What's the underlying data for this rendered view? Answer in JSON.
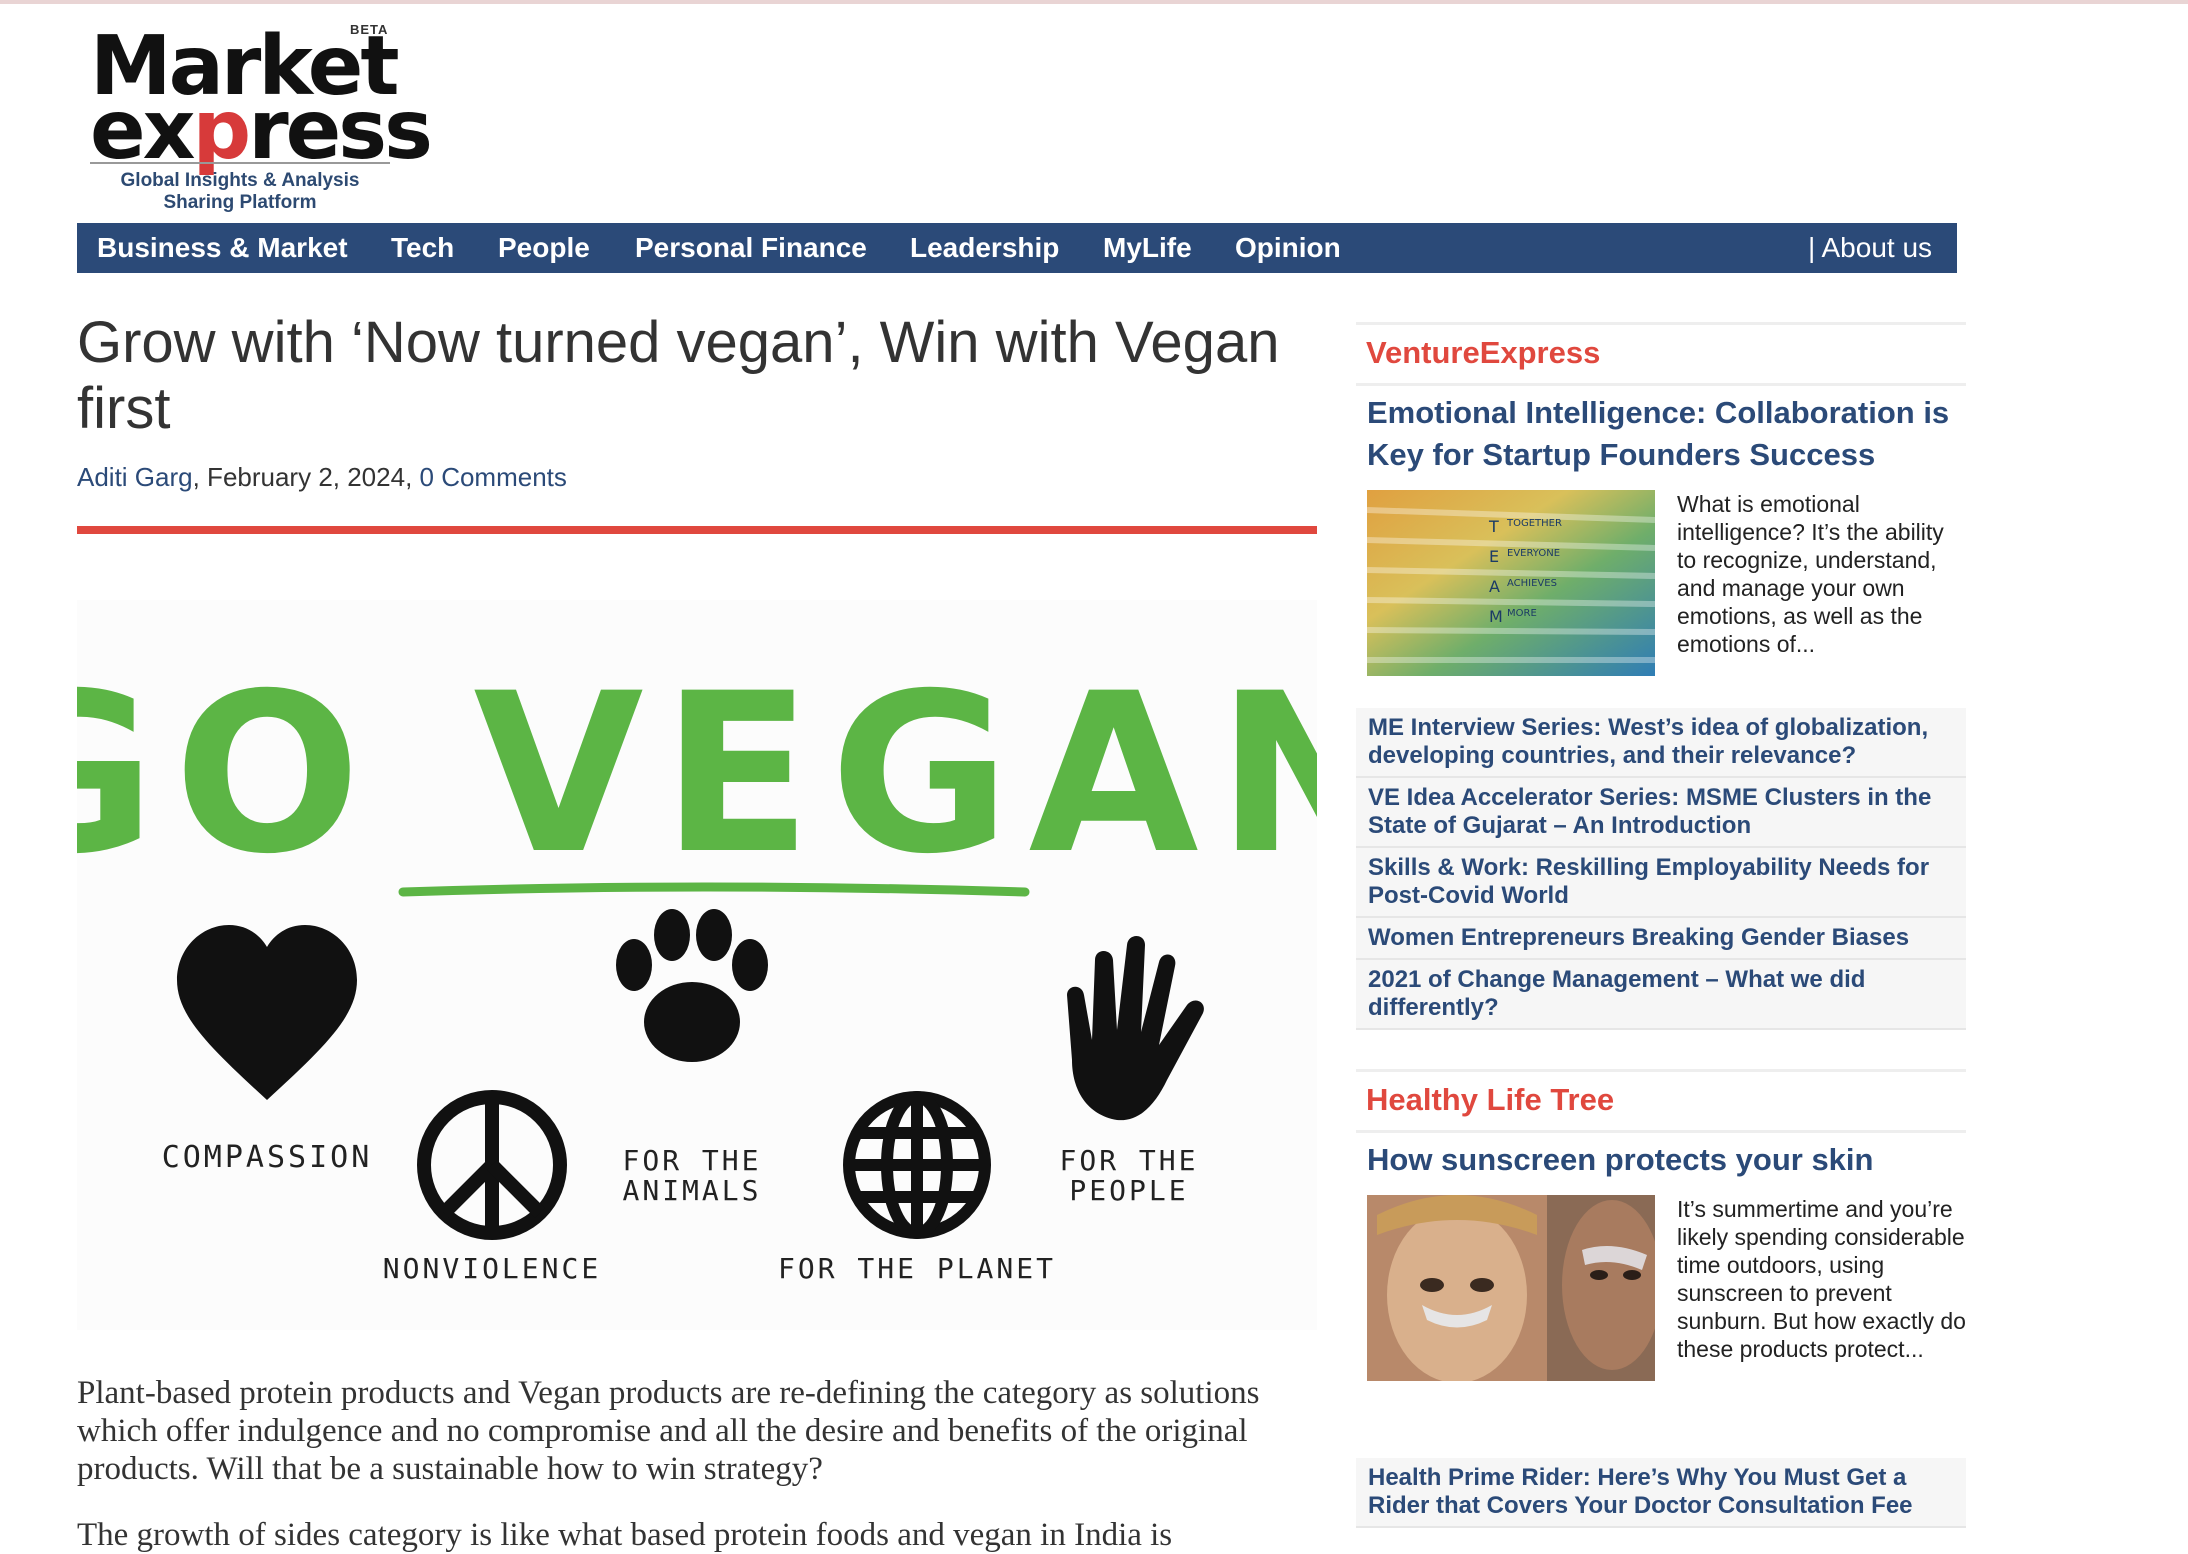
{
  "logo": {
    "beta": "BETA",
    "line1": "Market",
    "line2_a": "ex",
    "line2_p": "p",
    "line2_b": "ress",
    "tagline1": "Global Insights & Analysis",
    "tagline2": "Sharing Platform"
  },
  "nav": {
    "items": [
      "Business & Market",
      "Tech",
      "People",
      "Personal Finance",
      "Leadership",
      "MyLife",
      "Opinion"
    ],
    "about": "| About us"
  },
  "article": {
    "title": "Grow with ‘Now turned vegan’, Win with Vegan first",
    "author": "Aditi Garg",
    "date": ", February 2, 2024, ",
    "comments": "0 Comments",
    "hero": {
      "headline": "GO VEGAN",
      "labels": [
        "COMPASSION",
        "NONVIOLENCE",
        "FOR THE",
        "ANIMALS",
        "FOR THE PLANET",
        "FOR THE",
        "PEOPLE"
      ]
    },
    "paragraph1": "Plant-based protein products and Vegan products are re-defining the category as solutions which offer indulgence and no compromise and all the desire and benefits of the original products. Will that be a sustainable how to win strategy?",
    "paragraph2": "The growth of sides category is like what based protein foods and vegan in India is"
  },
  "sidebar": {
    "venture": {
      "heading": "VentureExpress",
      "feature_title": "Emotional Intelligence: Collaboration is Key for Startup Founders Success",
      "feature_text": "What is emotional intelligence? It’s the ability to recognize, understand, and manage your own emotions, as well as the emotions of...",
      "image_words": [
        "T",
        "TOGETHER",
        "E",
        "EVERYONE",
        "A",
        "ACHIEVES",
        "M",
        "MORE"
      ],
      "links": [
        "ME Interview Series: West’s idea of globalization, developing countries, and their relevance?",
        "VE Idea Accelerator Series: MSME Clusters in the State of Gujarat – An Introduction",
        "Skills & Work: Reskilling Employability Needs for Post-Covid World",
        "Women Entrepreneurs Breaking Gender Biases",
        "2021 of Change Management – What we did differently?"
      ]
    },
    "health": {
      "heading": "Healthy Life Tree",
      "feature_title": "How sunscreen protects your skin",
      "feature_text": "It’s summertime and you’re likely spending considerable time outdoors, using sunscreen to prevent sunburn. But how exactly do these products protect...",
      "links": [
        "Health Prime Rider: Here’s Why You Must Get a Rider that Covers Your Doctor Consultation Fee"
      ]
    }
  },
  "colors": {
    "nav_bg": "#2b4a78",
    "accent_red": "#e0483e",
    "link_blue": "#2b4a78",
    "vegan_green": "#5cb545"
  }
}
